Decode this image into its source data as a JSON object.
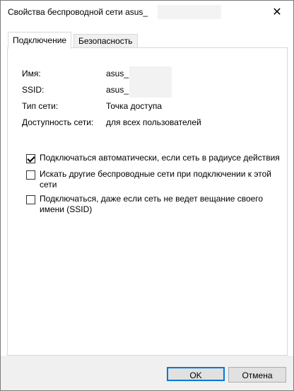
{
  "window": {
    "title": "Свойства беспроводной сети asus_",
    "close_glyph": "✕"
  },
  "tabs": [
    {
      "label": "Подключение",
      "active": true
    },
    {
      "label": "Безопасность",
      "active": false
    }
  ],
  "info": {
    "name_label": "Имя:",
    "name_value": "asus_",
    "ssid_label": "SSID:",
    "ssid_value": "asus_",
    "type_label": "Тип сети:",
    "type_value": "Точка доступа",
    "availability_label": "Доступность сети:",
    "availability_value": "для всех пользователей"
  },
  "options": [
    {
      "label": "Подключаться автоматически, если сеть в радиусе действия",
      "checked": true
    },
    {
      "label": "Искать другие беспроводные сети при подключении к этой сети",
      "checked": false
    },
    {
      "label": "Подключаться, даже если сеть не ведет вещание своего имени (SSID)",
      "checked": false
    }
  ],
  "buttons": {
    "ok": "OK",
    "cancel": "Отмена"
  }
}
